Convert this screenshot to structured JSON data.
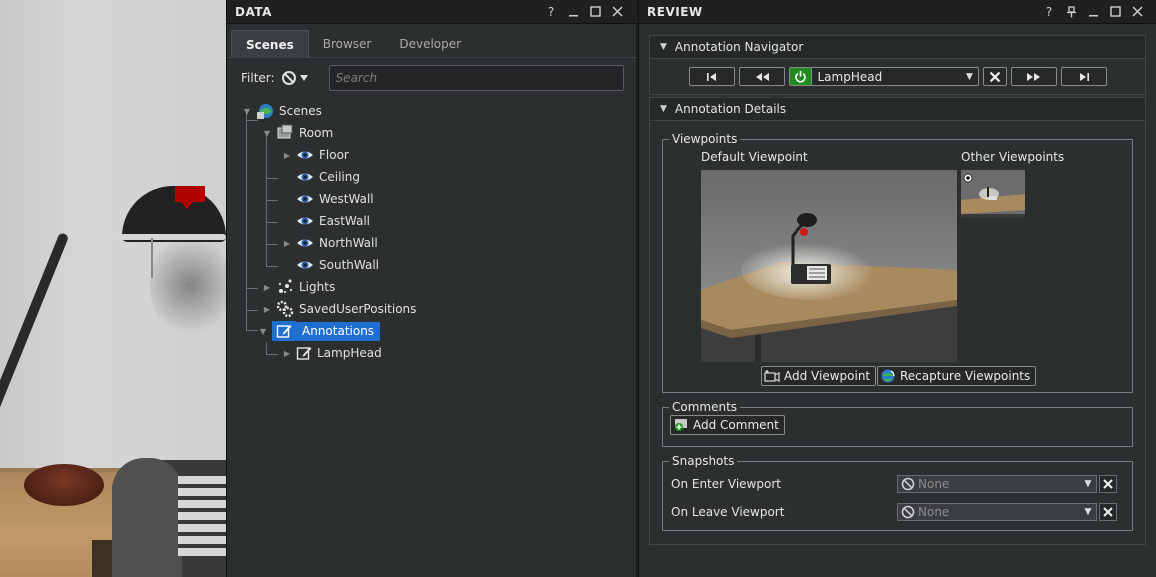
{
  "data_panel": {
    "title": "DATA",
    "title_buttons": [
      "?",
      "minimize",
      "maximize",
      "close"
    ],
    "tabs": [
      {
        "label": "Scenes",
        "active": true
      },
      {
        "label": "Browser",
        "active": false
      },
      {
        "label": "Developer",
        "active": false
      }
    ],
    "filter": {
      "label": "Filter:",
      "search_placeholder": "Search",
      "search_value": ""
    },
    "tree": [
      {
        "label": "Scenes",
        "icon": "globe-icon",
        "expanded": true
      },
      {
        "label": "Room",
        "icon": "room-icon",
        "expanded": true
      },
      {
        "label": "Floor",
        "icon": "eye-icon",
        "expanded": false
      },
      {
        "label": "Ceiling",
        "icon": "eye-icon"
      },
      {
        "label": "WestWall",
        "icon": "eye-icon"
      },
      {
        "label": "EastWall",
        "icon": "eye-icon"
      },
      {
        "label": "NorthWall",
        "icon": "eye-icon",
        "expanded": false
      },
      {
        "label": "SouthWall",
        "icon": "eye-icon"
      },
      {
        "label": "Lights",
        "icon": "sparkle-icon",
        "expanded": false
      },
      {
        "label": "SavedUserPositions",
        "icon": "gears-icon",
        "expanded": false
      },
      {
        "label": "Annotations",
        "icon": "edit-icon",
        "expanded": true,
        "selected": true
      },
      {
        "label": "LampHead",
        "icon": "edit-icon",
        "expanded": false
      }
    ]
  },
  "review_panel": {
    "title": "REVIEW",
    "title_buttons": [
      "?",
      "pin",
      "minimize",
      "maximize",
      "close"
    ],
    "annotation_navigator": {
      "header": "Annotation Navigator",
      "current_annotation": "LampHead",
      "enabled": true
    },
    "annotation_details": {
      "header": "Annotation Details",
      "viewpoints": {
        "group_title": "Viewpoints",
        "default_label": "Default Viewpoint",
        "other_label": "Other Viewpoints",
        "add_button": "Add Viewpoint",
        "recapture_button": "Recapture Viewpoints"
      },
      "comments": {
        "group_title": "Comments",
        "add_button": "Add Comment"
      },
      "snapshots": {
        "group_title": "Snapshots",
        "on_enter_label": "On Enter Viewport",
        "on_enter_value": "None",
        "on_leave_label": "On Leave Viewport",
        "on_leave_value": "None"
      }
    }
  },
  "colors": {
    "panel_bg": "#2c2f30",
    "titlebar_bg": "#1e2021",
    "selection": "#1f6fd1",
    "power_green": "#1f8b1f",
    "marker_red": "#b00000"
  }
}
